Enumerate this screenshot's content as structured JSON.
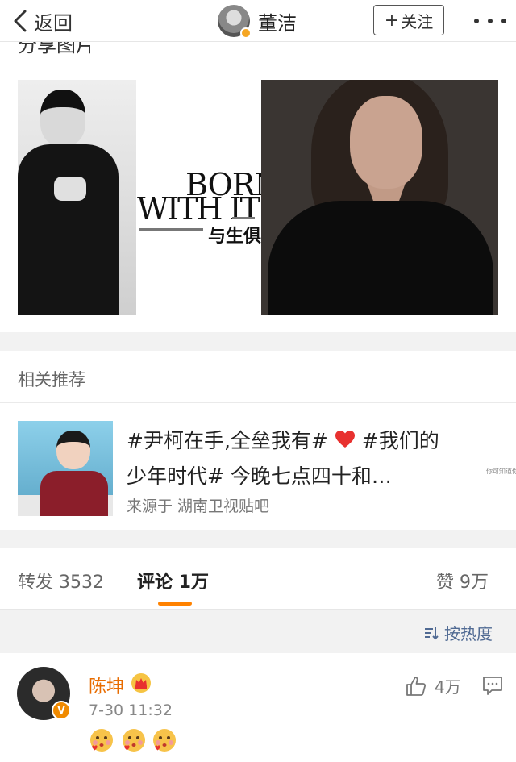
{
  "navbar": {
    "back_label": "返回",
    "username": "董洁",
    "follow_label": "关注"
  },
  "share": {
    "title": "分享图片",
    "magazine_line1": "BORN",
    "magazine_line2": "WITH IT",
    "magazine_cn": "与生俱来"
  },
  "recommendation": {
    "section_title": "相关推荐",
    "text_part1": "#尹柯在手,全垒我有#",
    "text_part2": "#我们的少年时代# 今晚七点四十和…",
    "source": "来源于 湖南卫视贴吧",
    "tiny_caption": "你可知道你"
  },
  "stats": {
    "repost": "转发 3532",
    "comment": "评论 1万",
    "like": "赞 9万"
  },
  "sort": {
    "label": "按热度"
  },
  "comment": {
    "author": "陈坤",
    "time": "7-30 11:32",
    "likes": "4万",
    "badge": "V",
    "emoji_count": 3
  },
  "colors": {
    "accent_orange": "#ff8200",
    "name_orange": "#e86c00",
    "link_blue": "#506a93",
    "heart_red": "#e8312f"
  }
}
